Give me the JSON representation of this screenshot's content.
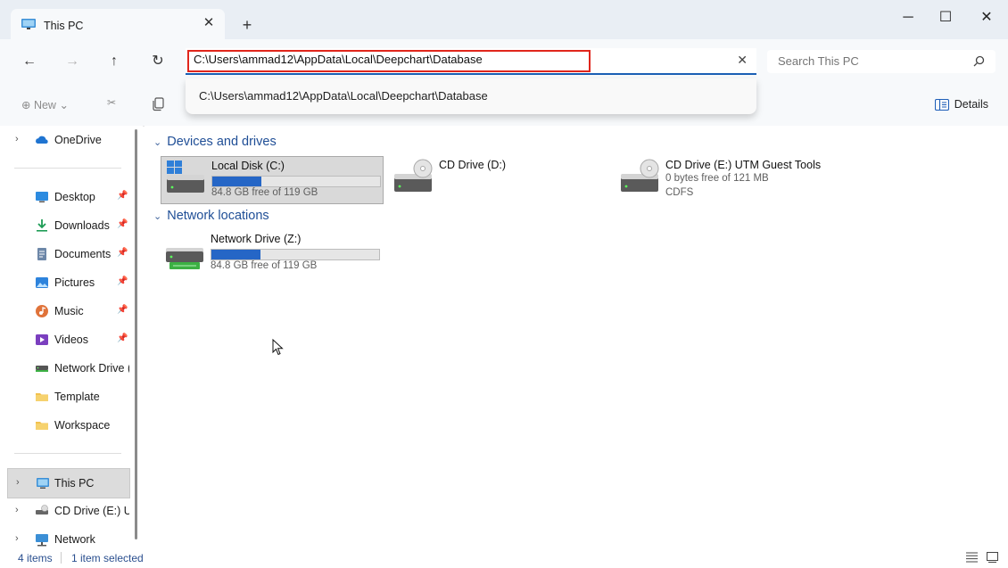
{
  "tab": {
    "title": "This PC",
    "icon": "this-pc-icon"
  },
  "window_controls": {
    "minimize": "─",
    "maximize": "☐",
    "close": "✕"
  },
  "address": {
    "value": "C:\\Users\\ammad12\\AppData\\Local\\Deepchart\\Database"
  },
  "dropdown": {
    "suggestion": "C:\\Users\\ammad12\\AppData\\Local\\Deepchart\\Database"
  },
  "search": {
    "placeholder": "Search This PC"
  },
  "commands": {
    "new_label": "New",
    "details_label": "Details"
  },
  "sidebar": {
    "items": [
      {
        "label": "OneDrive",
        "icon": "onedrive-icon"
      },
      {
        "label": "Desktop",
        "icon": "desktop-icon"
      },
      {
        "label": "Downloads",
        "icon": "downloads-icon"
      },
      {
        "label": "Documents",
        "icon": "documents-icon"
      },
      {
        "label": "Pictures",
        "icon": "pictures-icon"
      },
      {
        "label": "Music",
        "icon": "music-icon"
      },
      {
        "label": "Videos",
        "icon": "videos-icon"
      },
      {
        "label": "Network Drive (Z:)",
        "icon": "network-drive-icon"
      },
      {
        "label": "Template",
        "icon": "folder-icon"
      },
      {
        "label": "Workspace",
        "icon": "folder-icon"
      },
      {
        "label": "This PC",
        "icon": "this-pc-icon"
      },
      {
        "label": "CD Drive (E:) UTM Guest Tools",
        "icon": "cd-drive-icon"
      },
      {
        "label": "Network",
        "icon": "network-icon"
      }
    ]
  },
  "groups": {
    "devices": {
      "title": "Devices and drives"
    },
    "network": {
      "title": "Network locations"
    }
  },
  "drives": {
    "c": {
      "name": "Local Disk (C:)",
      "free": "84.8 GB free of 119 GB",
      "used_fraction": 0.29
    },
    "d": {
      "name": "CD Drive (D:)"
    },
    "e": {
      "name": "CD Drive (E:) UTM Guest Tools",
      "free": "0 bytes free of 121 MB",
      "fs": "CDFS"
    },
    "z": {
      "name": "Network Drive (Z:)",
      "free": "84.8 GB free of 119 GB",
      "used_fraction": 0.29
    }
  },
  "status": {
    "items": "4 items",
    "selected": "1 item selected"
  }
}
